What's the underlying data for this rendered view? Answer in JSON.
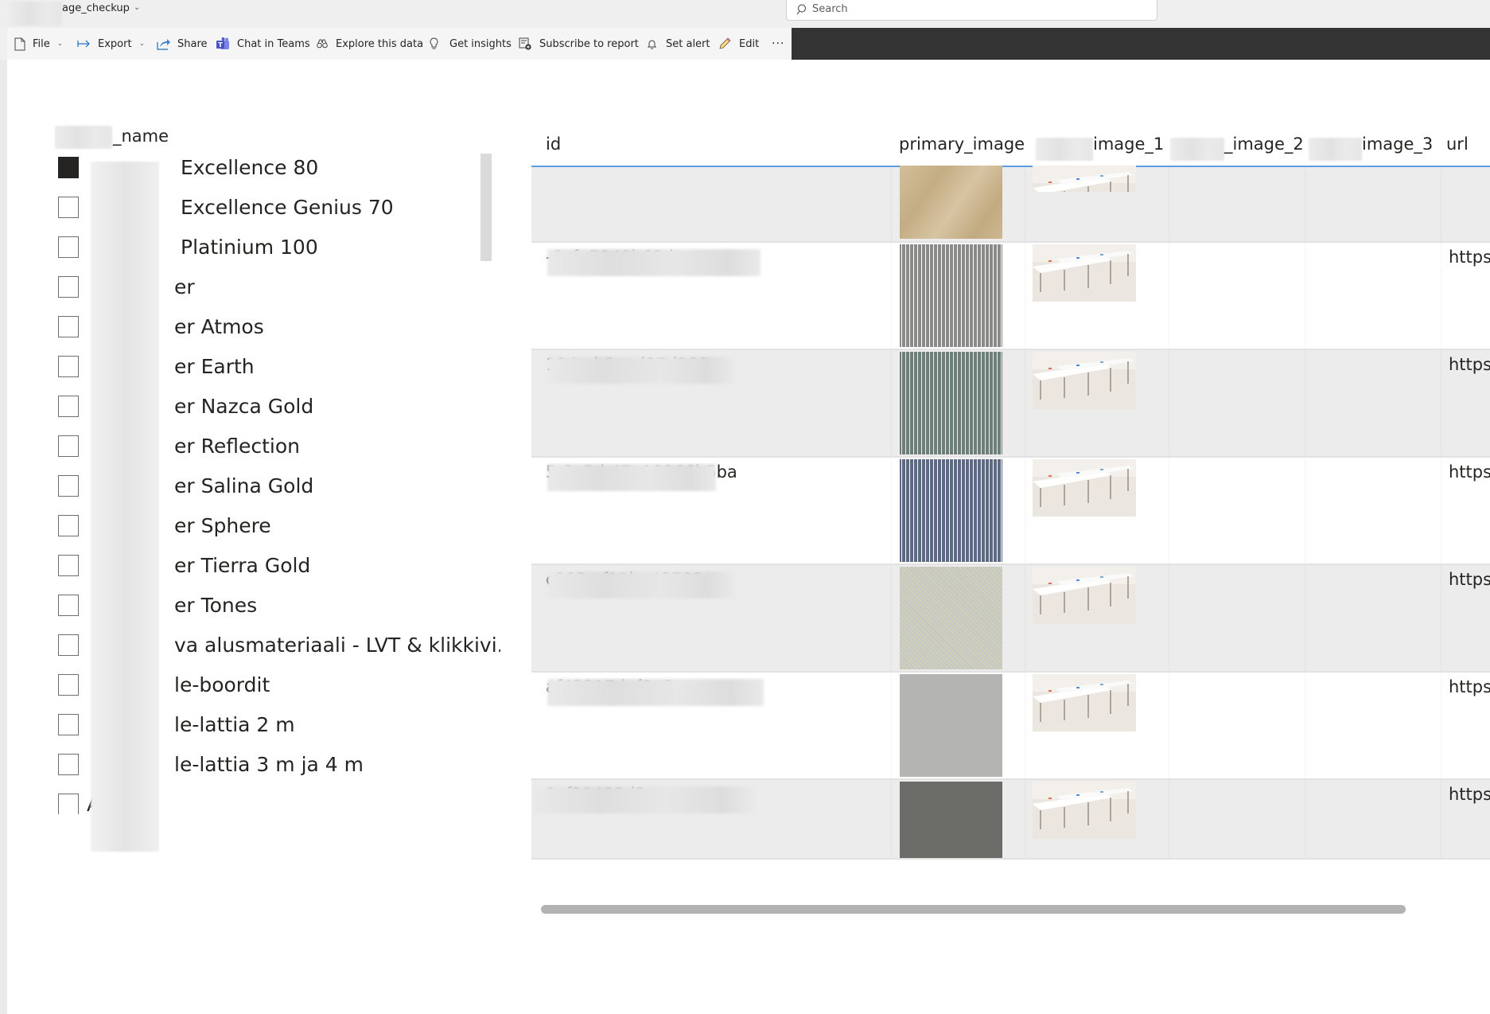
{
  "app": {
    "report_title": "age_checkup",
    "search_placeholder": "Search"
  },
  "toolbar": {
    "items": [
      {
        "label": "File",
        "icon": "file-icon",
        "has_dropdown": true
      },
      {
        "label": "Export",
        "icon": "export-arrow-icon",
        "has_dropdown": true
      },
      {
        "label": "Share",
        "icon": "share-icon",
        "has_dropdown": false
      },
      {
        "label": "Chat in Teams",
        "icon": "teams-icon",
        "has_dropdown": false
      },
      {
        "label": "Explore this data",
        "icon": "binoculars-icon",
        "has_dropdown": false
      },
      {
        "label": "Get insights",
        "icon": "lightbulb-icon",
        "has_dropdown": false
      },
      {
        "label": "Subscribe to report",
        "icon": "subscribe-icon",
        "has_dropdown": false
      },
      {
        "label": "Set alert",
        "icon": "bell-icon",
        "has_dropdown": false
      },
      {
        "label": "Edit",
        "icon": "pencil-icon",
        "has_dropdown": false
      }
    ],
    "more_label": "···"
  },
  "slicer": {
    "title": "_name",
    "items": [
      {
        "label": "Excellence 80",
        "checked": true
      },
      {
        "label": "Excellence Genius 70",
        "checked": false
      },
      {
        "label": "Platinium 100",
        "checked": false
      },
      {
        "label": "er",
        "checked": false
      },
      {
        "label": "er Atmos",
        "checked": false
      },
      {
        "label": "er Earth",
        "checked": false
      },
      {
        "label": "er Nazca Gold",
        "checked": false
      },
      {
        "label": "er Reflection",
        "checked": false
      },
      {
        "label": "er Salina Gold",
        "checked": false
      },
      {
        "label": "er Sphere",
        "checked": false
      },
      {
        "label": "er Tierra Gold",
        "checked": false
      },
      {
        "label": "er Tones",
        "checked": false
      },
      {
        "label": "va alusmateriaali - LVT & klikkivi...",
        "checked": false
      },
      {
        "label": "le-boordit",
        "checked": false
      },
      {
        "label": "le-lattia 2 m",
        "checked": false
      },
      {
        "label": "le-lattia 3 m ja 4 m",
        "checked": false
      },
      {
        "label": "A",
        "checked": false
      }
    ]
  },
  "table": {
    "columns": [
      "id",
      "primary_image",
      "image_1",
      "_image_2",
      "image_3",
      "url"
    ],
    "rows": [
      {
        "id": "",
        "swatch": "#c9b48e",
        "swatch_kind": "wood",
        "has_image_1": true,
        "url": ""
      },
      {
        "id": "-6afe7040b62d",
        "swatch": "#8a8b89",
        "swatch_kind": "lines",
        "has_image_1": true,
        "url": "https:/"
      },
      {
        "id": "124-eb3ced07d280",
        "swatch": "#6e7f7a",
        "swatch_kind": "lines",
        "has_image_1": true,
        "url": "https:/"
      },
      {
        "id": "5-8e5d-47a19066b5ba",
        "swatch": "#5d6a80",
        "swatch_kind": "lines",
        "has_image_1": true,
        "url": "https:/"
      },
      {
        "id": "c202-cf11be42782a",
        "swatch": "#c7c4b4",
        "swatch_kind": "noise",
        "has_image_1": true,
        "url": "https:/"
      },
      {
        "id": "af43317daf9e8",
        "swatch": "#b4b4b3",
        "swatch_kind": "plain",
        "has_image_1": true,
        "url": "https:/"
      },
      {
        "id": "3cf39453d2ea",
        "swatch": "#6c6d69",
        "swatch_kind": "plain",
        "has_image_1": true,
        "url": "https:/"
      }
    ]
  },
  "colors": {
    "accent_line": "#5c9de6",
    "dark_bar": "#333333"
  }
}
